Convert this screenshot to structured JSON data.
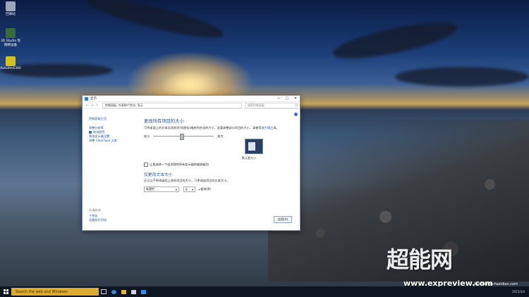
{
  "desktop": {
    "icons": [
      {
        "label": "回收站",
        "color": "#9aa7b8"
      },
      {
        "label": "3D Studio 等 网络设备",
        "color": "#3a6b3a"
      },
      {
        "label": "Autodesk360",
        "color": "#d2c21c"
      }
    ]
  },
  "window": {
    "title": "显示",
    "breadcrumbs": [
      "控制面板",
      "外观和个性化",
      "显示"
    ],
    "search_placeholder": "搜索控制面板",
    "sidebar": {
      "home": "控制面板主页",
      "links": [
        "调整分辨率",
        "校准颜色",
        "更改显示器设置",
        "调整 ClearType 文本"
      ]
    },
    "see_also": {
      "heading": "另请参阅",
      "links": [
        "个性化",
        "设备和打印机"
      ]
    },
    "main": {
      "heading": "更改所有项目的大小",
      "description": "可将桌面上的文本及其他项(如图标)缩放到合适的大小，若要调整部分项目的大小，请使用",
      "description_link": "放大镜",
      "description_suffix": "工具。",
      "slider_min": "较小",
      "slider_max": "较大",
      "preview_label": "默认更大小",
      "custom_check_label": "让我选择一个适合我的所有显示器的缩放级别",
      "text_heading": "仅更改文本大小",
      "text_description": "还可以不更改桌面上其他项目的大小，只更改该项目的文本大小。",
      "item_select": "标题栏",
      "size_select": "9",
      "bold_label": "粗体(B)",
      "apply_button": "应用(A)"
    }
  },
  "taskbar": {
    "search_placeholder": "Search the web and Windows",
    "clock_line1": "",
    "clock_line2": "2015/3/4"
  },
  "watermark": {
    "logo_text": "超能网",
    "url": "www.expreview.com",
    "sub": "jiaocheng.chazidian.com"
  }
}
